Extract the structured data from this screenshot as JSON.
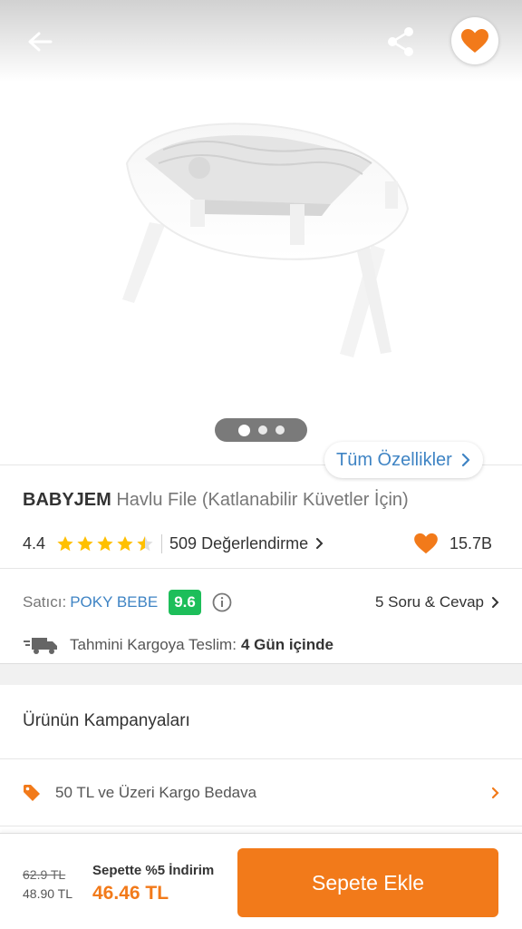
{
  "top_bar": {
    "back_icon": "arrow-left-icon",
    "share_icon": "share-icon",
    "favorite_icon": "heart-icon"
  },
  "gallery": {
    "image_count": 3,
    "active_index": 0,
    "all_features_label": "Tüm Özellikler"
  },
  "product": {
    "brand": "BABYJEM",
    "name": "Havlu File (Katlanabilir Küvetler İçin)",
    "rating": "4.4",
    "rating_value": 4.4,
    "reviews_label": "509 Değerlendirme",
    "likes": "15.7B"
  },
  "seller": {
    "label": "Satıcı:",
    "name": "POKY BEBE",
    "score": "9.6",
    "qa_label": "5 Soru & Cevap"
  },
  "shipping": {
    "label": "Tahmini Kargoya Teslim:",
    "value": "4 Gün içinde"
  },
  "campaigns": {
    "title": "Ürünün Kampanyaları",
    "items": [
      {
        "text": "50 TL ve Üzeri Kargo Bedava"
      }
    ]
  },
  "bottom_bar": {
    "old_price": "62.9 TL",
    "sale_price": "48.90 TL",
    "discount_label": "Sepette %5 İndirim",
    "discount_price": "46.46 TL",
    "add_to_cart_label": "Sepete Ekle"
  },
  "colors": {
    "accent": "#f27a1a",
    "link": "#3f84c4",
    "score_green": "#1dbe5a",
    "star": "#ffc000"
  }
}
